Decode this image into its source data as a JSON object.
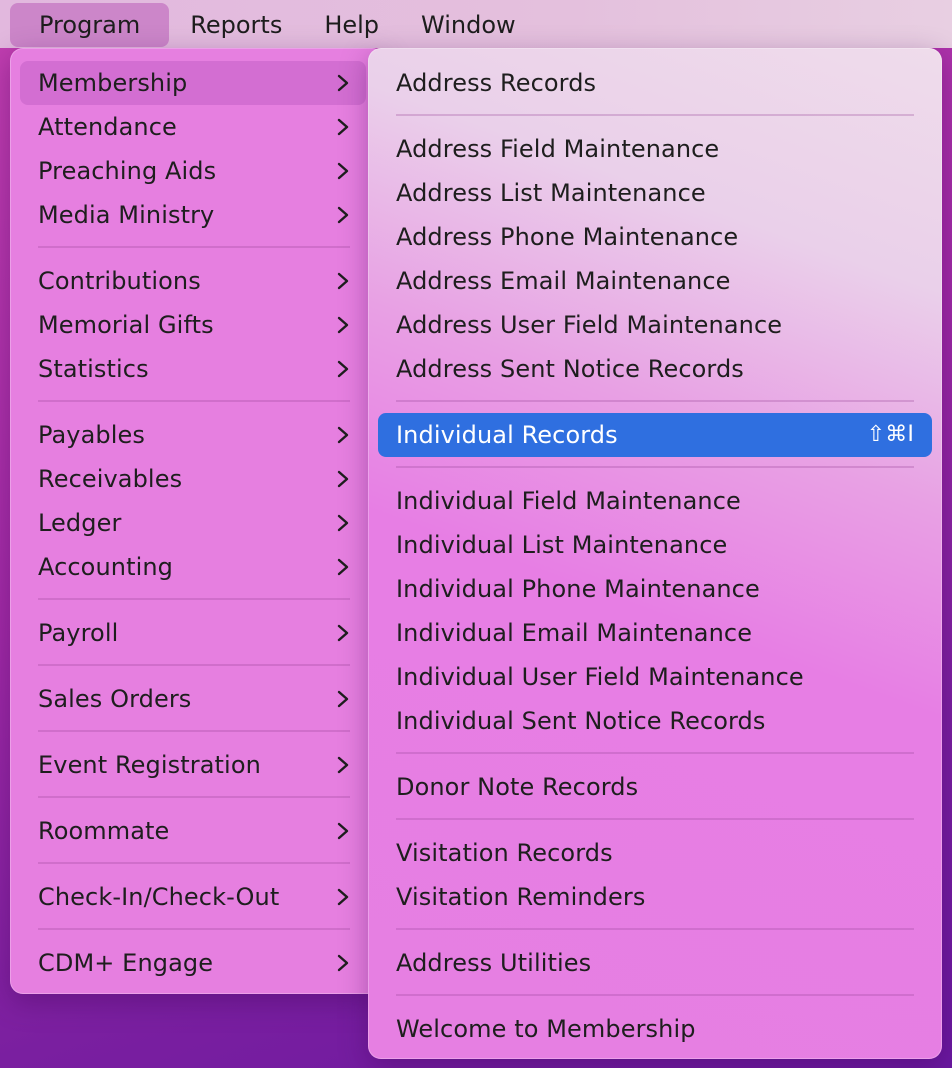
{
  "menubar": {
    "items": [
      "Program",
      "Reports",
      "Help",
      "Window"
    ]
  },
  "program_menu": {
    "items": [
      "Membership",
      "Attendance",
      "Preaching Aids",
      "Media Ministry",
      "Contributions",
      "Memorial Gifts",
      "Statistics",
      "Payables",
      "Receivables",
      "Ledger",
      "Accounting",
      "Payroll",
      "Sales Orders",
      "Event Registration",
      "Roommate",
      "Check-In/Check-Out",
      "CDM+ Engage"
    ]
  },
  "membership_menu": {
    "items": [
      "Address Records",
      "Address Field Maintenance",
      "Address List Maintenance",
      "Address Phone Maintenance",
      "Address Email Maintenance",
      "Address User Field Maintenance",
      "Address Sent Notice Records",
      "Individual Records",
      "Individual Field Maintenance",
      "Individual List Maintenance",
      "Individual Phone Maintenance",
      "Individual Email Maintenance",
      "Individual User Field Maintenance",
      "Individual Sent Notice Records",
      "Donor Note Records",
      "Visitation Records",
      "Visitation Reminders",
      "Address Utilities",
      "Welcome to Membership"
    ],
    "selected_shortcut": "⇧⌘I"
  },
  "colors": {
    "selection": "#2f6fe0",
    "menu_bg": "#e67fe0"
  }
}
